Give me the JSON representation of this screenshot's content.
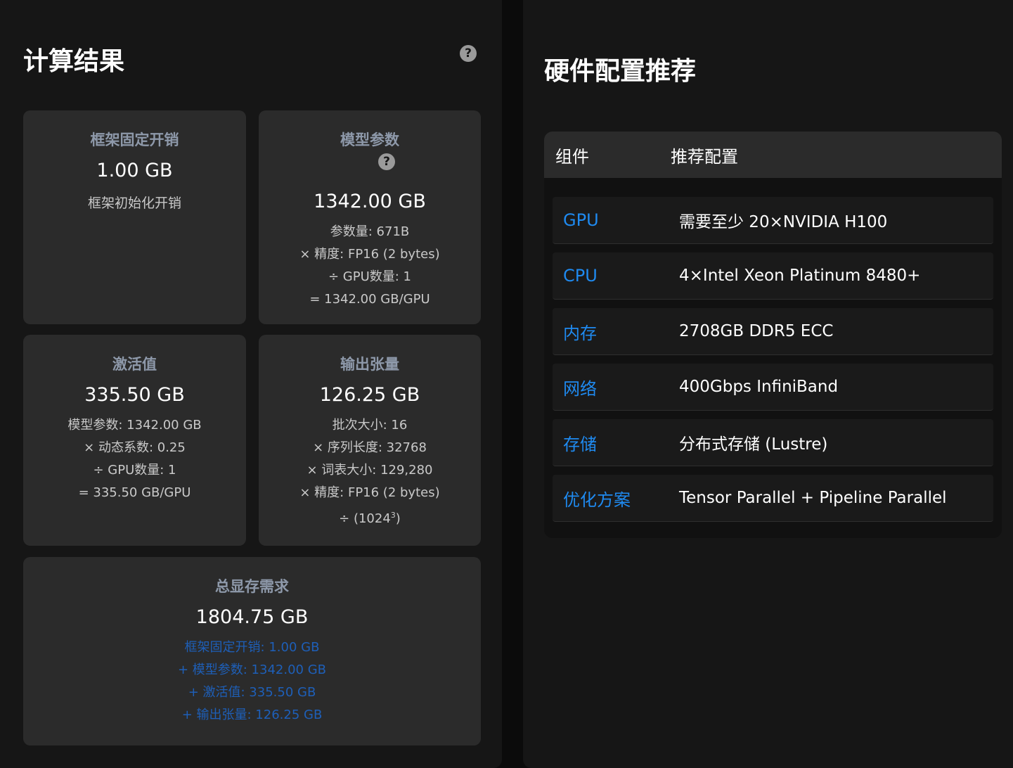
{
  "left": {
    "title": "计算结果",
    "help_icon": "question-circle-icon",
    "cards": {
      "framework": {
        "title": "框架固定开销",
        "value": "1.00 GB",
        "desc": "框架初始化开销"
      },
      "params": {
        "title": "模型参数",
        "value": "1342.00 GB",
        "lines": [
          "参数量: 671B",
          "× 精度: FP16 (2 bytes)",
          "÷ GPU数量: 1",
          "= 1342.00 GB/GPU"
        ]
      },
      "activations": {
        "title": "激活值",
        "value": "335.50 GB",
        "lines": [
          "模型参数: 1342.00 GB",
          "× 动态系数: 0.25",
          "÷ GPU数量: 1",
          "= 335.50 GB/GPU"
        ]
      },
      "output": {
        "title": "输出张量",
        "value": "126.25 GB",
        "lines": [
          "批次大小: 16",
          "× 序列长度: 32768",
          "× 词表大小: 129,280",
          "× 精度: FP16 (2 bytes)",
          "÷ (1024",
          "3",
          ")"
        ]
      },
      "total": {
        "title": "总显存需求",
        "value": "1804.75 GB",
        "lines": [
          "框架固定开销: 1.00 GB",
          "+ 模型参数: 1342.00 GB",
          "+ 激活值: 335.50 GB",
          "+ 输出张量: 126.25 GB"
        ]
      }
    }
  },
  "right": {
    "title": "硬件配置推荐",
    "table": {
      "headers": [
        "组件",
        "推荐配置"
      ],
      "rows": [
        {
          "component": "GPU",
          "spec": "需要至少 20×NVIDIA H100"
        },
        {
          "component": "CPU",
          "spec": "4×Intel Xeon Platinum 8480+"
        },
        {
          "component": "内存",
          "spec": "2708GB DDR5 ECC"
        },
        {
          "component": "网络",
          "spec": "400Gbps InfiniBand"
        },
        {
          "component": "存储",
          "spec": "分布式存储 (Lustre)"
        },
        {
          "component": "优化方案",
          "spec": "Tensor Parallel + Pipeline Parallel"
        }
      ]
    }
  },
  "colors": {
    "card_title": "#8e99aa",
    "accent_blue": "#1f8af0",
    "total_lines_blue": "#1e5fb8"
  }
}
